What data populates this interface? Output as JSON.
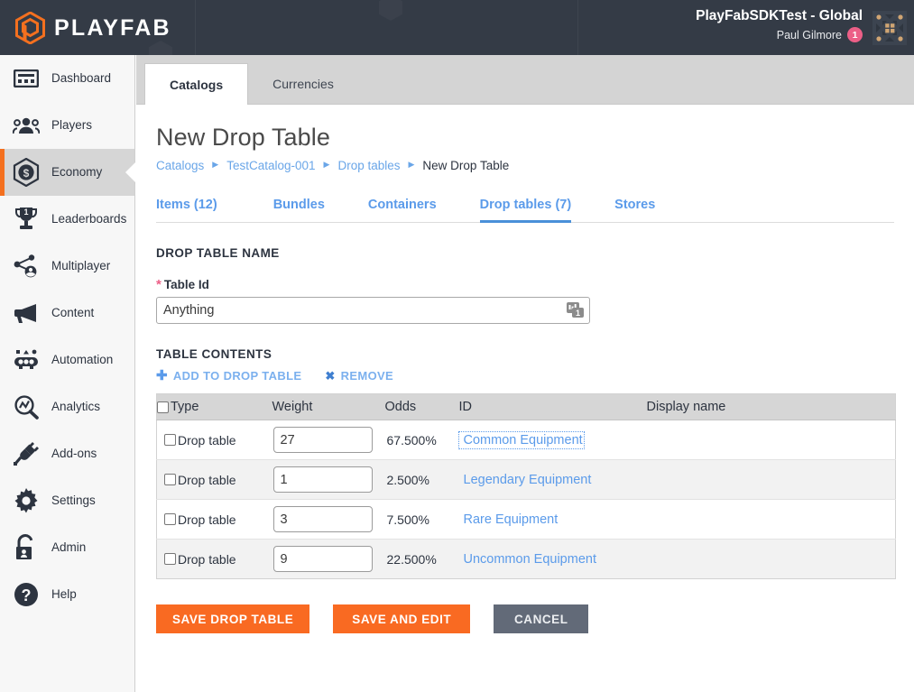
{
  "header": {
    "brand_name": "PLAYFAB",
    "brand_icon": "playfab-hex-logo",
    "title": "PlayFabSDKTest - Global",
    "user_name": "Paul Gilmore",
    "badge_count": "1",
    "grid_icon": "app-grid-icon",
    "colors": {
      "background": "#343b46",
      "badge": "#ec5f87",
      "brand_orange": "#f4701f"
    }
  },
  "sidebar": {
    "items": [
      {
        "label": "Dashboard",
        "icon": "dashboard-icon",
        "active": false
      },
      {
        "label": "Players",
        "icon": "players-icon",
        "active": false
      },
      {
        "label": "Economy",
        "icon": "economy-coin-icon",
        "active": true
      },
      {
        "label": "Leaderboards",
        "icon": "trophy-icon",
        "active": false
      },
      {
        "label": "Multiplayer",
        "icon": "multiplayer-icon",
        "active": false
      },
      {
        "label": "Content",
        "icon": "megaphone-icon",
        "active": false
      },
      {
        "label": "Automation",
        "icon": "automation-icon",
        "active": false
      },
      {
        "label": "Analytics",
        "icon": "analytics-icon",
        "active": false
      },
      {
        "label": "Add-ons",
        "icon": "plug-icon",
        "active": false
      },
      {
        "label": "Settings",
        "icon": "gear-icon",
        "active": false
      },
      {
        "label": "Admin",
        "icon": "lock-icon",
        "active": false
      },
      {
        "label": "Help",
        "icon": "question-icon",
        "active": false
      }
    ]
  },
  "tabs": [
    {
      "label": "Catalogs",
      "active": true
    },
    {
      "label": "Currencies",
      "active": false
    }
  ],
  "page": {
    "title": "New Drop Table"
  },
  "breadcrumb": [
    {
      "label": "Catalogs",
      "link": true
    },
    {
      "label": "TestCatalog-001",
      "link": true
    },
    {
      "label": "Drop tables",
      "link": true
    },
    {
      "label": "New Drop Table",
      "link": false
    }
  ],
  "subtabs": [
    {
      "label": "Items (12)",
      "active": false
    },
    {
      "label": "Bundles",
      "active": false
    },
    {
      "label": "Containers",
      "active": false
    },
    {
      "label": "Drop tables (7)",
      "active": true
    },
    {
      "label": "Stores",
      "active": false
    }
  ],
  "form": {
    "section_title": "DROP TABLE NAME",
    "table_id_label": "Table Id",
    "required_marker": "*",
    "table_id_value": "Anything",
    "table_id_placeholder": "Table Id",
    "input_adornment_icon": "password-manager-fill-icon"
  },
  "table_contents": {
    "section_title": "TABLE CONTENTS",
    "add_label": "ADD TO DROP TABLE",
    "add_icon": "plus-icon",
    "remove_label": "REMOVE",
    "remove_icon": "cross-icon",
    "columns": [
      "Type",
      "Weight",
      "Odds",
      "ID",
      "Display name"
    ],
    "rows": [
      {
        "type": "Drop table",
        "weight": "27",
        "odds": "67.500%",
        "id": "Common Equipment",
        "display_name": "",
        "focused": true
      },
      {
        "type": "Drop table",
        "weight": "1",
        "odds": "2.500%",
        "id": "Legendary Equipment",
        "display_name": "",
        "focused": false
      },
      {
        "type": "Drop table",
        "weight": "3",
        "odds": "7.500%",
        "id": "Rare Equipment",
        "display_name": "",
        "focused": false
      },
      {
        "type": "Drop table",
        "weight": "9",
        "odds": "22.500%",
        "id": "Uncommon Equipment",
        "display_name": "",
        "focused": false
      }
    ]
  },
  "buttons": {
    "save": "SAVE DROP TABLE",
    "save_and_edit": "SAVE AND EDIT",
    "cancel": "CANCEL"
  }
}
